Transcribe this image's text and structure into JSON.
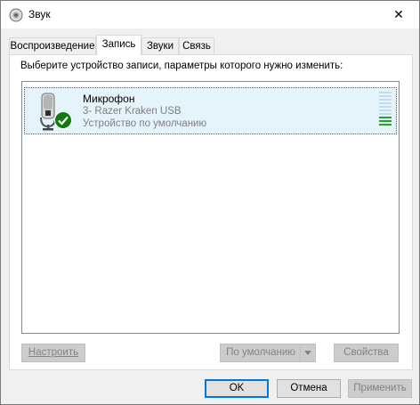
{
  "window": {
    "title": "Звук",
    "close_glyph": "✕"
  },
  "tabs": [
    {
      "label": "Воспроизведение",
      "active": false
    },
    {
      "label": "Запись",
      "active": true
    },
    {
      "label": "Звуки",
      "active": false
    },
    {
      "label": "Связь",
      "active": false
    }
  ],
  "panel": {
    "instruction": "Выберите устройство записи, параметры которого нужно изменить:",
    "devices": [
      {
        "name": "Микрофон",
        "subtitle": "3- Razer Kraken USB",
        "status": "Устройство по умолчанию",
        "icon": "microphone-icon",
        "badge": "default-check-icon",
        "level_segments_total": 10,
        "level_segments_on": 3
      }
    ],
    "configure_label": "Настроить",
    "set_default_label": "По умолчанию",
    "properties_label": "Свойства"
  },
  "footer": {
    "ok_label": "OK",
    "cancel_label": "Отмена",
    "apply_label": "Применить"
  },
  "colors": {
    "selection": "#e5f3fb",
    "accent": "#0078d7",
    "check_badge": "#107c10",
    "level_on": "#2ca02c",
    "level_off": "#c3dcec"
  }
}
